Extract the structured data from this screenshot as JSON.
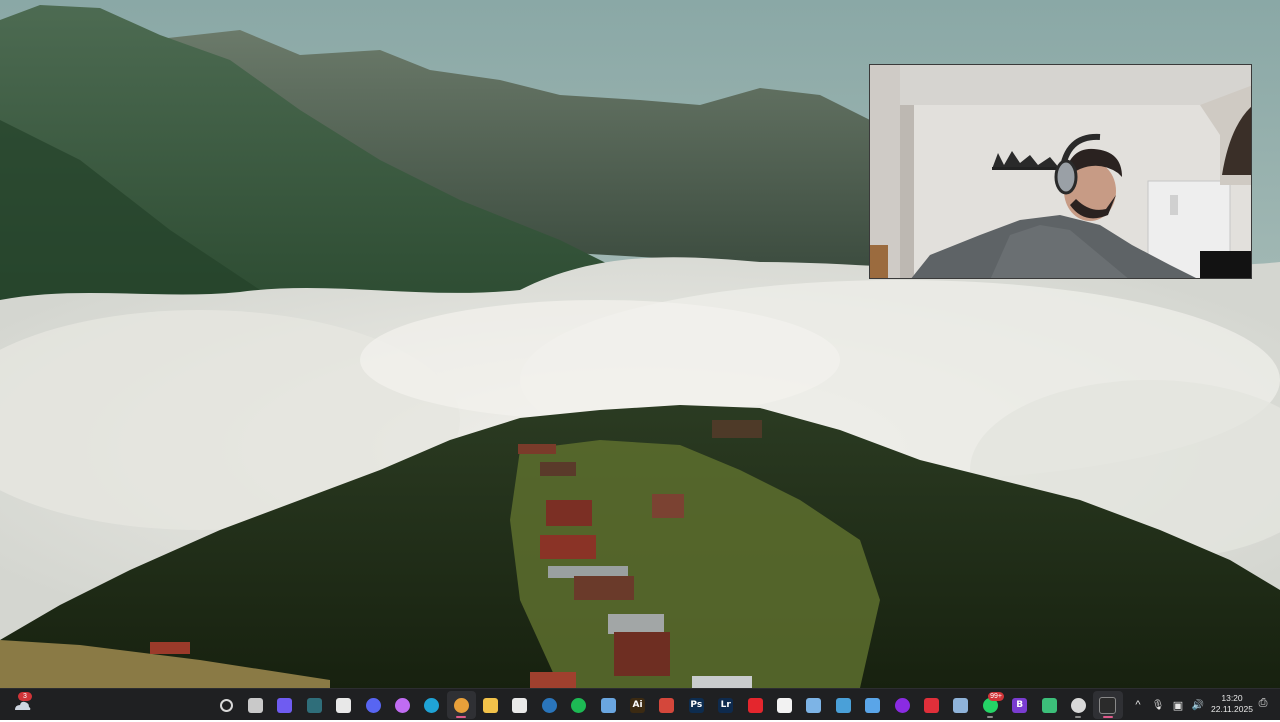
{
  "taskbar": {
    "weather_badge": "3",
    "apps": [
      {
        "name": "start",
        "icon": "windows-logo-icon",
        "glyph": "",
        "color": "#3aa0f3"
      },
      {
        "name": "search",
        "icon": "search-icon",
        "glyph": "",
        "color": "#d8d8d8"
      },
      {
        "name": "task-view",
        "icon": "task-view-icon",
        "glyph": "",
        "color": "#c9c9c9"
      },
      {
        "name": "meet",
        "icon": "meet-icon",
        "glyph": "",
        "color": "#6f5cf1"
      },
      {
        "name": "widgets",
        "icon": "widgets-icon",
        "glyph": "",
        "color": "#2f6e7a"
      },
      {
        "name": "store",
        "icon": "store-icon",
        "glyph": "",
        "color": "#e8e8e8"
      },
      {
        "name": "discord",
        "icon": "discord-icon",
        "glyph": "",
        "color": "#5865f2"
      },
      {
        "name": "copilot",
        "icon": "copilot-icon",
        "glyph": "",
        "color": "#c06cf2"
      },
      {
        "name": "edge",
        "icon": "edge-icon",
        "glyph": "",
        "color": "#1fa3d6"
      },
      {
        "name": "chrome",
        "icon": "chrome-icon",
        "glyph": "",
        "color": "#e8a03a"
      },
      {
        "name": "file-explorer",
        "icon": "folder-icon",
        "glyph": "",
        "color": "#f2c24a"
      },
      {
        "name": "app-red",
        "icon": "app-red-icon",
        "glyph": "",
        "color": "#e9e9e9"
      },
      {
        "name": "steam",
        "icon": "steam-icon",
        "glyph": "",
        "color": "#2a75bb"
      },
      {
        "name": "spotify",
        "icon": "spotify-icon",
        "glyph": "",
        "color": "#1db954"
      },
      {
        "name": "notepad",
        "icon": "notepad-icon",
        "glyph": "",
        "color": "#6aa6e0"
      },
      {
        "name": "illustrator",
        "icon": "illustrator-icon",
        "glyph": "Ai",
        "color": "#3b2a12"
      },
      {
        "name": "davinci",
        "icon": "davinci-icon",
        "glyph": "",
        "color": "#d4473b"
      },
      {
        "name": "photoshop",
        "icon": "photoshop-icon",
        "glyph": "Ps",
        "color": "#0d2c4f"
      },
      {
        "name": "lightroom",
        "icon": "lightroom-icon",
        "glyph": "Lr",
        "color": "#0e2a4d"
      },
      {
        "name": "acrobat",
        "icon": "acrobat-icon",
        "glyph": "",
        "color": "#e4262d"
      },
      {
        "name": "capcut",
        "icon": "capcut-icon",
        "glyph": "",
        "color": "#f2f2f2"
      },
      {
        "name": "photos",
        "icon": "photos-icon",
        "glyph": "",
        "color": "#7db4e6"
      },
      {
        "name": "screen-tool",
        "icon": "screen-tool-icon",
        "glyph": "",
        "color": "#4aa0d8"
      },
      {
        "name": "snipping",
        "icon": "snipping-icon",
        "glyph": "",
        "color": "#5aa5e8"
      },
      {
        "name": "obs-purple",
        "icon": "obs-icon",
        "glyph": "",
        "color": "#8a2be2"
      },
      {
        "name": "youtube-studio",
        "icon": "youtube-icon",
        "glyph": "",
        "color": "#e02f3a"
      },
      {
        "name": "settings",
        "icon": "gear-icon",
        "glyph": "",
        "color": "#8fb3d9"
      },
      {
        "name": "whatsapp",
        "icon": "whatsapp-icon",
        "glyph": "",
        "color": "#25d366",
        "badge": "99+"
      },
      {
        "name": "app-b",
        "icon": "app-b-icon",
        "glyph": "B",
        "color": "#7a3cd1"
      },
      {
        "name": "app-green",
        "icon": "app-green-icon",
        "glyph": "",
        "color": "#3cbf7a"
      },
      {
        "name": "obs",
        "icon": "obs-studio-icon",
        "glyph": "",
        "color": "#d8d8d8"
      },
      {
        "name": "recorder",
        "icon": "recorder-icon",
        "glyph": "",
        "color": "#2b2b2b"
      }
    ],
    "active_apps": [
      "chrome",
      "recorder"
    ],
    "running_apps": [
      "chrome",
      "recorder",
      "whatsapp",
      "obs"
    ],
    "tray": {
      "chevron": "^",
      "mic": "🎙",
      "network": "▣",
      "volume": "🔊"
    },
    "clock": {
      "time": "13:20",
      "date": "22.11.2025"
    },
    "notification": "⎙"
  }
}
